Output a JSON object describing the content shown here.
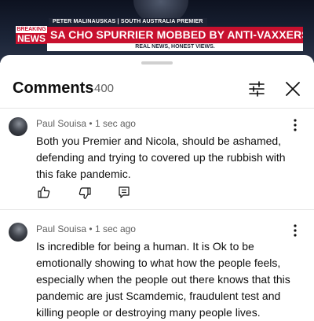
{
  "video": {
    "name_strip": "PETER MALINAUSKAS | SOUTH AUSTRALIA PREMIER",
    "logo_top": "BREAKING",
    "logo_bottom": "NEWS",
    "headline": "SA CHO SPURRIER MOBBED BY ANTI-VAXXERS",
    "tagline": "REAL NEWS, HONEST VIEWS."
  },
  "comments_panel": {
    "title": "Comments",
    "count": "400",
    "filter_icon": "sliders-icon",
    "close_icon": "close-icon"
  },
  "comments": [
    {
      "author": "Paul Souisa",
      "time": "1 sec ago",
      "text": "Both you Premier and Nicola, should be ashamed, defending and trying to covered up the rubbish with this fake pandemic.",
      "actions": [
        "thumbs-up-icon",
        "thumbs-down-icon",
        "reply-icon"
      ]
    },
    {
      "author": "Paul Souisa",
      "time": "1 sec ago",
      "text": "Is incredible for being a human. It is Ok to be emotionally showing to what how the people feels, especially when the people out there knows that this pandemic are just Scamdemic, fraudulent test and killing people or destroying many people lives."
    }
  ],
  "colors": {
    "breaking_red": "#c8102e",
    "text_primary": "#0f0f0f",
    "text_secondary": "#606060"
  }
}
